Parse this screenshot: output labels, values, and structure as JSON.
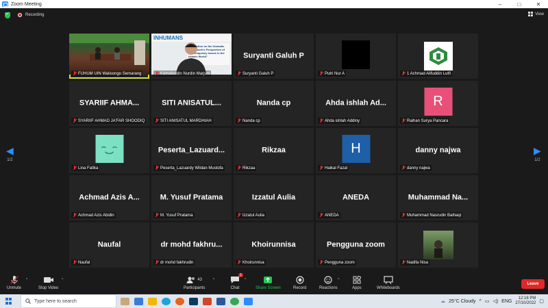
{
  "window": {
    "title": "Zoom Meeting",
    "minimize": "–",
    "maximize": "□",
    "close": "✕"
  },
  "topbar": {
    "recording": "Recording",
    "view": "View"
  },
  "pager": {
    "left": "1/2",
    "right": "1/2"
  },
  "tiles": [
    {
      "label": "FUHUM UIN Walisongo Semarang",
      "display": "",
      "kind": "video-stage",
      "active": true
    },
    {
      "label": "Kamaluddin Nurdin Marjuni",
      "display": "",
      "kind": "video-speaker",
      "banner": "INHUMANS",
      "slide": "\"Reflection on the Ummatic Framework's Perspective of Contemporary Issues in the Islamic World\""
    },
    {
      "label": "Suryanti Galuh P",
      "display": "Suryanti Galuh P",
      "kind": "name"
    },
    {
      "label": "Putri Nur A",
      "display": "",
      "kind": "black"
    },
    {
      "label": "1 Achmad Alifuddin Lutfi",
      "display": "",
      "kind": "logo"
    },
    {
      "label": "SYARIIF AHMAD JA'FAR SHOODIQ",
      "display": "SYARIIF AHMA...",
      "kind": "name"
    },
    {
      "label": "SITI ANISATUL MARDHIAH",
      "display": "SITI ANISATUL...",
      "kind": "name"
    },
    {
      "label": "Nanda cp",
      "display": "Nanda cp",
      "kind": "name"
    },
    {
      "label": "Ahda ishlah Addiny",
      "display": "Ahda ishlah Ad...",
      "kind": "name"
    },
    {
      "label": "Raihan Surya Pancara",
      "display": "R",
      "kind": "avatar",
      "color": "#e8507a"
    },
    {
      "label": "Lina Fatika",
      "display": "",
      "kind": "smile",
      "color": "#7de0c2"
    },
    {
      "label": "Peserta_Lazuardy Wildan Mustofa",
      "display": "Peserta_Lazuard...",
      "kind": "name"
    },
    {
      "label": "Rikzaa",
      "display": "Rikzaa",
      "kind": "name"
    },
    {
      "label": "Haikal Fazal",
      "display": "H",
      "kind": "avatar",
      "color": "#1e5fa8"
    },
    {
      "label": "danny najwa",
      "display": "danny najwa",
      "kind": "name"
    },
    {
      "label": "Achmad Azis Abidin",
      "display": "Achmad Azis A...",
      "kind": "name"
    },
    {
      "label": "M. Yusuf Pratama",
      "display": "M. Yusuf Pratama",
      "kind": "name"
    },
    {
      "label": "Izzatul Aulia",
      "display": "Izzatul Aulia",
      "kind": "name"
    },
    {
      "label": "ANEDA",
      "display": "ANEDA",
      "kind": "name"
    },
    {
      "label": "Muhammad Nasrudin Baihaqi",
      "display": "Muhammad Na...",
      "kind": "name"
    },
    {
      "label": "Naufal",
      "display": "Naufal",
      "kind": "name"
    },
    {
      "label": "dr mohd fakhrudin",
      "display": "dr mohd fakhru...",
      "kind": "name"
    },
    {
      "label": "Khoirunnisa",
      "display": "Khoirunnisa",
      "kind": "name"
    },
    {
      "label": "Pengguna zoom",
      "display": "Pengguna zoom",
      "kind": "name"
    },
    {
      "label": "Nadifa Nisa",
      "display": "",
      "kind": "photo"
    }
  ],
  "toolbar": {
    "unmute": "Unmute",
    "stop_video": "Stop Video",
    "participants": "Participants",
    "participant_count": "43",
    "chat": "Chat",
    "chat_badge": "1",
    "share_screen": "Share Screen",
    "record": "Record",
    "reactions": "Reactions",
    "apps": "Apps",
    "whiteboards": "Whiteboards",
    "leave": "Leave"
  },
  "taskbar": {
    "search_placeholder": "Type here to search",
    "weather": "25°C  Cloudy",
    "language": "ENG",
    "time": "12:18 PM",
    "date": "27/10/2022"
  },
  "colors": {
    "accent": "#2d8cff",
    "leave": "#e02828",
    "active_speaker": "#d6e23a",
    "share": "#23c552"
  }
}
